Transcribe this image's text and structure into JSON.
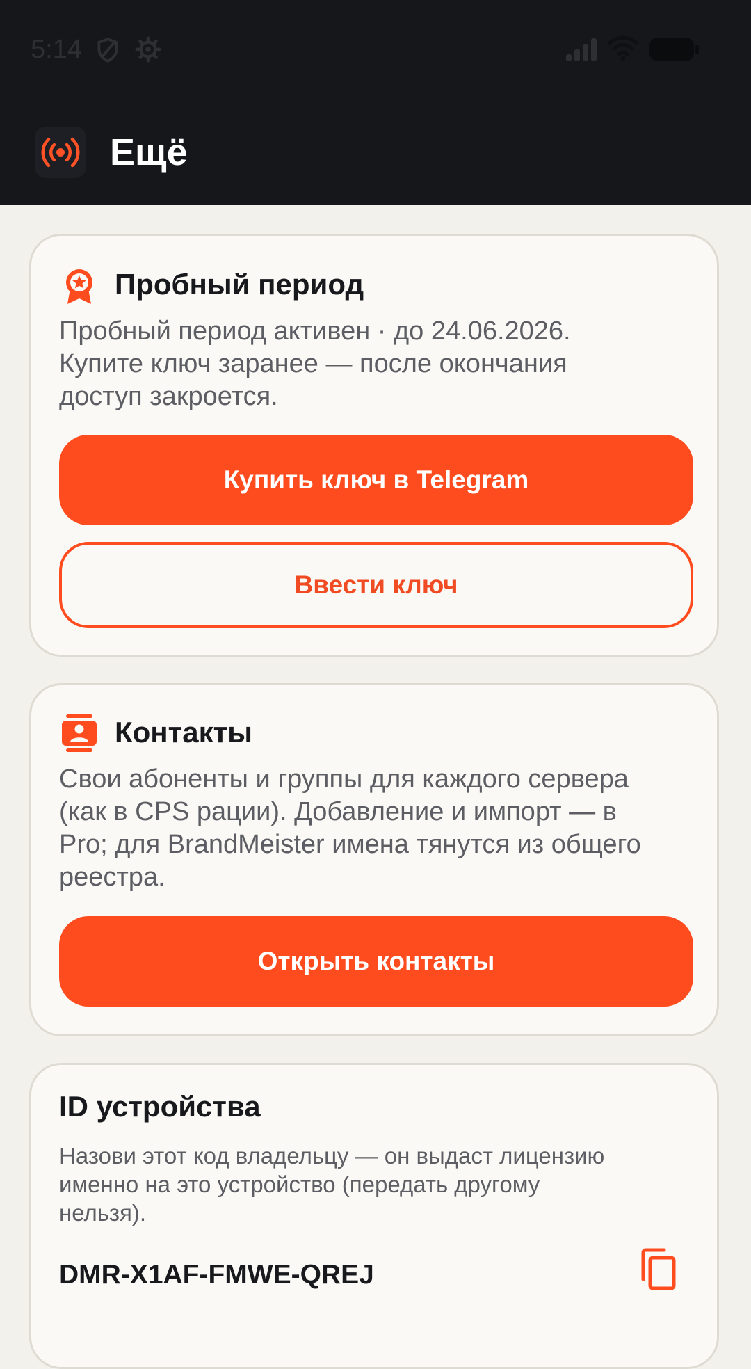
{
  "status_bar": {
    "time": "5:14",
    "icons": [
      "shield-icon",
      "gear-icon",
      "signal-icon",
      "wifi-icon",
      "battery-icon"
    ]
  },
  "app_bar": {
    "icon": "radio-broadcast-icon",
    "title": "Ещё"
  },
  "trial_card": {
    "icon": "award-badge-icon",
    "title": "Пробный период",
    "text_line1": "Пробный период активен · до 24.06.2026.",
    "text_line2": "Купите ключ заранее — после окончания",
    "text_line3": "доступ закроется.",
    "buy_button_label": "Купить ключ в Telegram",
    "enter_key_button_label": "Ввести ключ"
  },
  "contacts_card": {
    "icon": "contacts-icon",
    "title": "Контакты",
    "text_line1": "Свои абоненты и группы для каждого сервера",
    "text_line2": "(как в CPS рации). Добавление и импорт — в",
    "text_line3": "Pro; для BrandMeister имена тянутся из общего",
    "text_line4": "реестра.",
    "open_button_label": "Открыть контакты"
  },
  "device_card": {
    "title": "ID устройства",
    "text_line1": "Назови этот код владельцу — он выдаст лицензию",
    "text_line2": "именно на это устройство (передать другому",
    "text_line3": "нельзя).",
    "device_id": "DMR-X1AF-FMWE-QREJ",
    "copy_icon": "copy-icon"
  },
  "colors": {
    "accent": "#ff4c1f",
    "header_bg": "#16171b",
    "page_bg": "#f2f1ec",
    "card_bg": "#faf9f6"
  }
}
